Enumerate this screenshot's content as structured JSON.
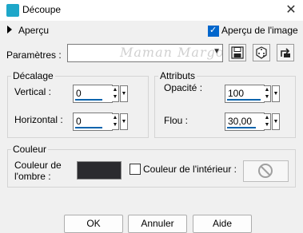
{
  "window": {
    "title": "Découpe"
  },
  "top": {
    "apercu_label": "Aperçu",
    "preview_label": "Aperçu de l'image",
    "preview_checked": true
  },
  "params": {
    "label": "Paramètres :",
    "value": "",
    "watermark": "Maman Margo"
  },
  "toolbar": {
    "save_icon": "floppy-icon",
    "random_icon": "dice-icon",
    "reset_icon": "reset-icon"
  },
  "offset": {
    "title": "Décalage",
    "vertical_label": "Vertical :",
    "vertical_value": "0",
    "horizontal_label": "Horizontal :",
    "horizontal_value": "0"
  },
  "attributes": {
    "title": "Attributs",
    "opacity_label": "Opacité :",
    "opacity_value": "100",
    "blur_label": "Flou :",
    "blur_value": "30,00"
  },
  "color": {
    "title": "Couleur",
    "shadow_label_1": "Couleur de",
    "shadow_label_2": "l'ombre :",
    "shadow_color": "#2b2b2f",
    "interior_label": "Couleur de l'intérieur :",
    "interior_checked": false
  },
  "buttons": {
    "ok": "OK",
    "cancel": "Annuler",
    "help": "Aide"
  },
  "accent": "#0a64ad"
}
